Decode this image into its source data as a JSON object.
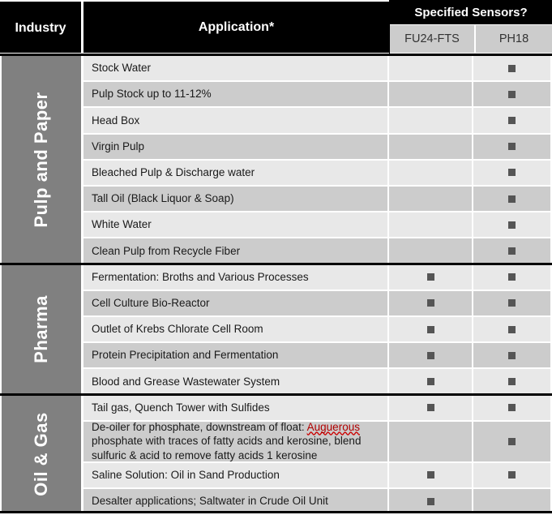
{
  "header": {
    "industry_label": "Industry",
    "application_label": "Application*",
    "specified_sensors_label": "Specified Sensors?",
    "sensor_columns": [
      "FU24-FTS",
      "PH18"
    ]
  },
  "colors": {
    "header_bg": "#000000",
    "header_text": "#ffffff",
    "industry_bg": "#808080",
    "subheader_bg": "#cccccc",
    "row_light": "#e8e8e8",
    "row_dark": "#cccccc",
    "mark": "#555555",
    "spellcheck_underline": "#cc0000"
  },
  "sections": [
    {
      "industry": "Pulp and Paper",
      "rows": [
        {
          "application": "Stock Water",
          "fu24_fts": false,
          "ph18": true
        },
        {
          "application": "Pulp Stock up to 11-12%",
          "fu24_fts": false,
          "ph18": true
        },
        {
          "application": "Head Box",
          "fu24_fts": false,
          "ph18": true
        },
        {
          "application": "Virgin Pulp",
          "fu24_fts": false,
          "ph18": true
        },
        {
          "application": "Bleached Pulp & Discharge water",
          "fu24_fts": false,
          "ph18": true
        },
        {
          "application": "Tall Oil (Black Liquor & Soap)",
          "fu24_fts": false,
          "ph18": true
        },
        {
          "application": "White Water",
          "fu24_fts": false,
          "ph18": true
        },
        {
          "application": "Clean Pulp from Recycle Fiber",
          "fu24_fts": false,
          "ph18": true
        }
      ]
    },
    {
      "industry": "Pharma",
      "rows": [
        {
          "application": "Fermentation: Broths and Various Processes",
          "fu24_fts": true,
          "ph18": true
        },
        {
          "application": "Cell Culture Bio-Reactor",
          "fu24_fts": true,
          "ph18": true
        },
        {
          "application": "Outlet of Krebs Chlorate Cell Room",
          "fu24_fts": true,
          "ph18": true
        },
        {
          "application": "Protein Precipitation and Fermentation",
          "fu24_fts": true,
          "ph18": true
        },
        {
          "application": "Blood and Grease Wastewater System",
          "fu24_fts": true,
          "ph18": true
        }
      ]
    },
    {
      "industry": "Oil & Gas",
      "rows": [
        {
          "application": "Tail gas, Quench Tower with Sulfides",
          "fu24_fts": true,
          "ph18": true
        },
        {
          "application_prefix": "De-oiler for phosphate, downstream of float: ",
          "application_misspelled": "Auguerous",
          "application_suffix": " phosphate with traces of fatty acids and kerosine, blend sulfuric & acid to remove fatty acids 1 kerosine",
          "application": "De-oiler for phosphate, downstream of float: Auguerous phosphate with traces of fatty acids and kerosine, blend sulfuric & acid to remove fatty acids 1 kerosine",
          "fu24_fts": false,
          "ph18": true
        },
        {
          "application": "Saline Solution: Oil in Sand Production",
          "fu24_fts": true,
          "ph18": true
        },
        {
          "application": "Desalter applications; Saltwater in Crude Oil Unit",
          "fu24_fts": true,
          "ph18": false
        }
      ]
    }
  ]
}
